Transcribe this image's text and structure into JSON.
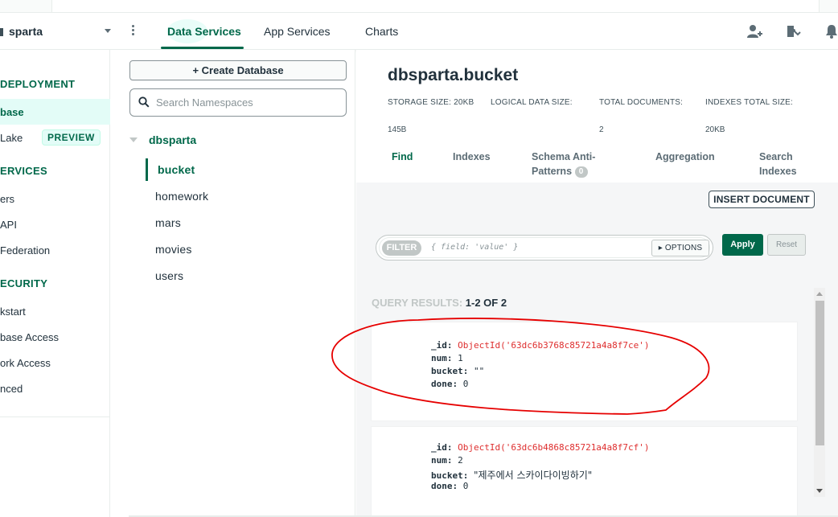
{
  "topbar": {
    "project": "sparta",
    "tabs": [
      {
        "label": "Data Services",
        "active": true
      },
      {
        "label": "App Services",
        "active": false
      },
      {
        "label": "Charts",
        "active": false
      }
    ],
    "icons": [
      "add-user-icon",
      "integrations-icon",
      "bell-icon"
    ]
  },
  "leftnav": {
    "deployment_heading": "DEPLOYMENT",
    "database_item": "base",
    "lake_item": "Lake",
    "preview_badge": "PREVIEW",
    "services_heading": "ERVICES",
    "triggers_item": "ers",
    "api_item": "API",
    "federation_item": "Federation",
    "security_heading": "ECURITY",
    "quickstart_item": "kstart",
    "db_access_item": "base Access",
    "net_access_item": "ork Access",
    "advanced_item": "nced"
  },
  "dbpanel": {
    "create_label": "+ Create Database",
    "search_placeholder": "Search Namespaces",
    "database": "dbsparta",
    "collections": [
      "bucket",
      "homework",
      "mars",
      "movies",
      "users"
    ]
  },
  "main": {
    "title": "dbsparta.bucket",
    "stats": {
      "storage_label": "STORAGE SIZE: 20KB",
      "logical_label": "LOGICAL DATA SIZE:",
      "logical_value": "145B",
      "total_docs_label": "TOTAL DOCUMENTS:",
      "total_docs_value": "2",
      "indexes_label": "INDEXES TOTAL SIZE:",
      "indexes_value": "20KB"
    },
    "tabs": {
      "find": "Find",
      "indexes": "Indexes",
      "schema_line1": "Schema Anti-",
      "schema_line2": "Patterns",
      "schema_count": "0",
      "aggregation": "Aggregation",
      "search_line1": "Search",
      "search_line2": "Indexes"
    },
    "insert_label": "INSERT DOCUMENT",
    "filter": {
      "pill": "FILTER",
      "placeholder": "{ field: 'value' }",
      "options": "▸ OPTIONS",
      "apply": "Apply",
      "reset": "Reset"
    },
    "query_results_label": "QUERY RESULTS: ",
    "query_results_range": "1-2 OF 2",
    "documents": [
      {
        "id_key": "_id:",
        "id_value": "ObjectId('63dc6b3768c85721a4a8f7ce')",
        "num_key": "num:",
        "num_value": "1",
        "bucket_key": "bucket:",
        "bucket_value": "\"\"",
        "done_key": "done:",
        "done_value": "0"
      },
      {
        "id_key": "_id:",
        "id_value": "ObjectId('63dc6b4868c85721a4a8f7cf')",
        "num_key": "num:",
        "num_value": "2",
        "bucket_key": "bucket:",
        "bucket_value": "\"제주에서 스카이다이빙하기\"",
        "done_key": "done:",
        "done_value": "0"
      }
    ]
  },
  "colors": {
    "accent": "#00684a",
    "annotation": "#e60000",
    "object_id": "#de2e2e"
  }
}
